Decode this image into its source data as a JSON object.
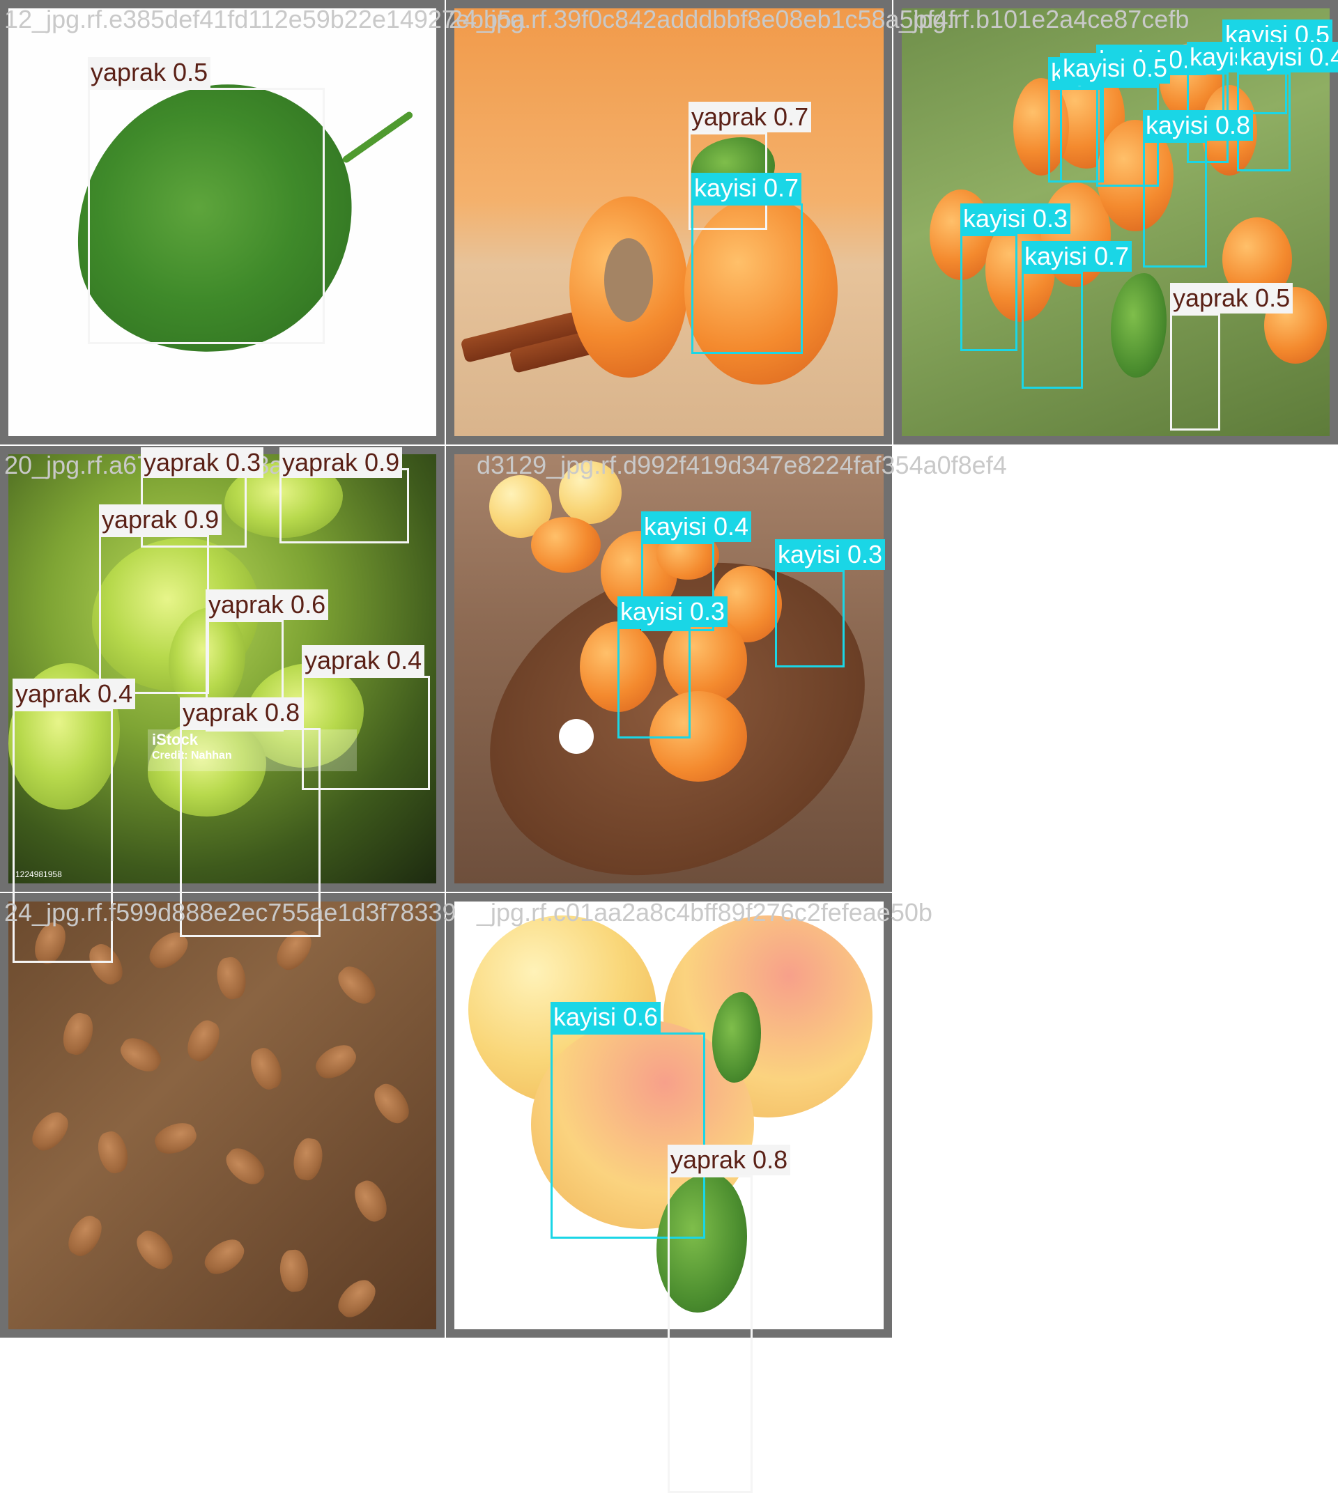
{
  "class_colors": {
    "yaprak": "#f5f5f5",
    "kayisi": "#1ad6e6"
  },
  "tiles": [
    {
      "filename": "12_jpg.rf.e385def41fd112e59b22e14927ebb5a",
      "detections": [
        {
          "class": "yaprak",
          "label": "yaprak 0.5"
        }
      ]
    },
    {
      "filename": "24_jpg.rf.39f0c842adddbbf8e08eb1c58a5bf4f",
      "detections": [
        {
          "class": "yaprak",
          "label": "yaprak 0.7"
        },
        {
          "class": "kayisi",
          "label": "kayisi 0.7"
        }
      ]
    },
    {
      "filename": "_jpg.rf.b101e2a4ce87cefb",
      "detections": [
        {
          "class": "kayisi",
          "label": "kayisi 0.5"
        },
        {
          "class": "kayisi",
          "label": "kayisi 0.4"
        },
        {
          "class": "kayisi",
          "label": "kayisi 0.5"
        },
        {
          "class": "kayisi",
          "label": "kayisi"
        },
        {
          "class": "kayisi",
          "label": "kayisi 0.4"
        },
        {
          "class": "kayisi",
          "label": "kayisi 0.8"
        },
        {
          "class": "kayisi",
          "label": "kayisi 0.5"
        },
        {
          "class": "kayisi",
          "label": "kayisi 0.3"
        },
        {
          "class": "kayisi",
          "label": "kayisi 0.7"
        },
        {
          "class": "yaprak",
          "label": "yaprak 0.5"
        }
      ]
    },
    {
      "filename": "20_jpg.rf.a67441512f13a",
      "watermark": "iStock",
      "watermark_credit": "Credit: Nahhan",
      "stock_id": "1224981958",
      "detections": [
        {
          "class": "yaprak",
          "label": "yaprak 0.3"
        },
        {
          "class": "yaprak",
          "label": "yaprak 0.9"
        },
        {
          "class": "yaprak",
          "label": "yaprak 0.9"
        },
        {
          "class": "yaprak",
          "label": "yaprak 0.6"
        },
        {
          "class": "yaprak",
          "label": "yaprak 0.4"
        },
        {
          "class": "yaprak",
          "label": "yaprak 0.4"
        },
        {
          "class": "yaprak",
          "label": "yaprak 0.8"
        }
      ]
    },
    {
      "filename": "d3129_jpg.rf.d992f419d347e8224faf354a0f8ef4",
      "detections": [
        {
          "class": "kayisi",
          "label": "kayisi 0.4"
        },
        {
          "class": "kayisi",
          "label": "kayisi 0.3"
        },
        {
          "class": "kayisi",
          "label": "kayisi 0.3"
        }
      ]
    },
    {
      "filename": "24_jpg.rf.f599d888e2ec755ae1d3f78339",
      "detections": []
    },
    {
      "filename": "_jpg.rf.c01aa2a8c4bff89f276c2fefeae50b",
      "detections": [
        {
          "class": "kayisi",
          "label": "kayisi 0.6"
        },
        {
          "class": "yaprak",
          "label": "yaprak 0.8"
        }
      ]
    }
  ]
}
